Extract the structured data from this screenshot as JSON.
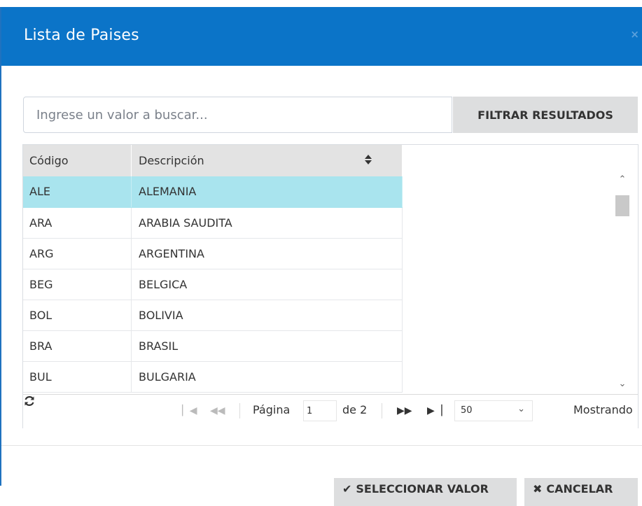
{
  "dialog": {
    "title": "Lista de Paises",
    "close": "×"
  },
  "search": {
    "placeholder": "Ingrese un valor a buscar...",
    "value": "",
    "filter_label": "FILTRAR RESULTADOS"
  },
  "grid": {
    "columns": [
      "Código",
      "Descripción"
    ],
    "rows": [
      {
        "code": "ALE",
        "desc": "ALEMANIA"
      },
      {
        "code": "ARA",
        "desc": "ARABIA SAUDITA"
      },
      {
        "code": "ARG",
        "desc": "ARGENTINA"
      },
      {
        "code": "BEG",
        "desc": "BELGICA"
      },
      {
        "code": "BOL",
        "desc": "BOLIVIA"
      },
      {
        "code": "BRA",
        "desc": "BRASIL"
      },
      {
        "code": "BUL",
        "desc": "BULGARIA"
      }
    ],
    "selected_index": 0
  },
  "pager": {
    "page_label": "Página",
    "page_value": "1",
    "of_label": "de 2",
    "page_size": "50",
    "info": "Mostrando"
  },
  "footer": {
    "select_label": "SELECCIONAR VALOR",
    "cancel_label": "CANCELAR"
  },
  "colors": {
    "header": "#0b74c8",
    "selected_row": "#a9e4ee",
    "button_bg": "#dddedf"
  }
}
